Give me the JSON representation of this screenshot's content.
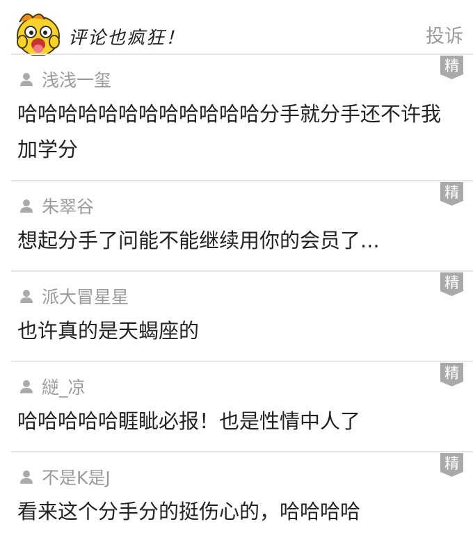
{
  "header": {
    "title": "评论也疯狂！",
    "report_label": "投诉"
  },
  "badge_label": "精",
  "comments": [
    {
      "user": "浅浅一玺",
      "text": "哈哈哈哈哈哈哈哈哈哈哈哈分手就分手还不许我加学分"
    },
    {
      "user": "朱翠谷",
      "text": "想起分手了问能不能继续用你的会员了..."
    },
    {
      "user": "派大冒星星",
      "text": "也许真的是天蝎座的"
    },
    {
      "user": "縌_凉",
      "text": "哈哈哈哈哈睚眦必报！也是性情中人了"
    },
    {
      "user": "不是K是J",
      "text": "看来这个分手分的挺伤心的，哈哈哈哈"
    }
  ],
  "icons": [
    "mascot-icon",
    "user-icon",
    "featured-badge-icon"
  ],
  "colors": {
    "badge": "#a9a9a9",
    "muted_text": "#9a9a9a",
    "body_text": "#222222",
    "divider": "#e6e6e6"
  }
}
